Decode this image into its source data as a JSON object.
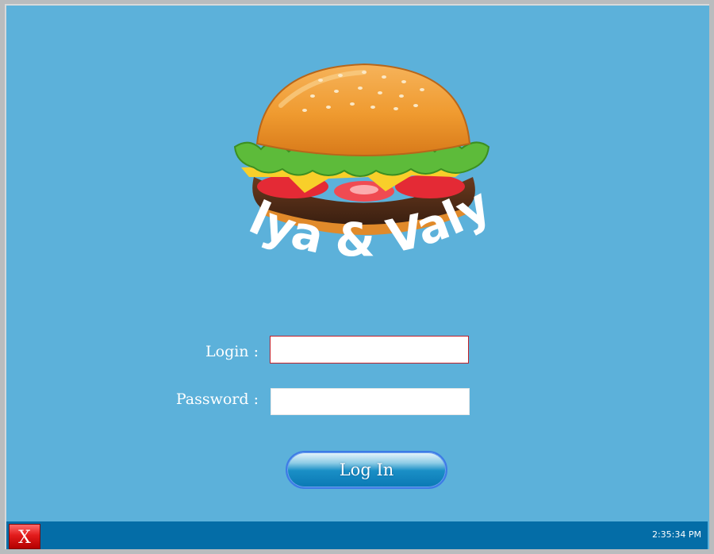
{
  "logo": {
    "brand_text": "Olya & Valya",
    "icon": "burger-icon"
  },
  "form": {
    "login_label": "Login :",
    "login_value": "",
    "password_label": "Password :",
    "password_value": ""
  },
  "actions": {
    "login_button_label": "Log In"
  },
  "statusbar": {
    "close_label": "X",
    "close_icon": "close-icon",
    "clock": "2:35:34 PM"
  },
  "colors": {
    "background": "#5cb1da",
    "statusbar": "#046da7",
    "close_button": "#e21b1b",
    "login_border": "#c0202a"
  }
}
